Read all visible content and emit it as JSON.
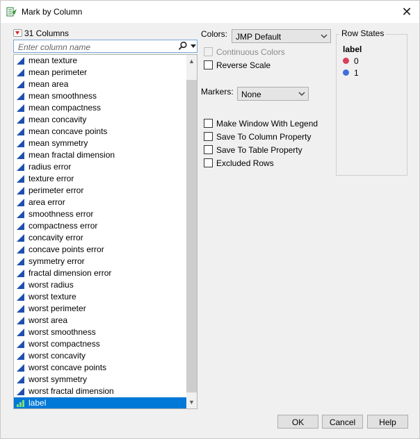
{
  "window": {
    "title": "Mark by Column",
    "close_glyph": "✕"
  },
  "columns": {
    "count_label": "31 Columns",
    "search_placeholder": "Enter column name",
    "items": [
      {
        "label": "mean texture",
        "type": "continuous"
      },
      {
        "label": "mean perimeter",
        "type": "continuous"
      },
      {
        "label": "mean area",
        "type": "continuous"
      },
      {
        "label": "mean smoothness",
        "type": "continuous"
      },
      {
        "label": "mean compactness",
        "type": "continuous"
      },
      {
        "label": "mean concavity",
        "type": "continuous"
      },
      {
        "label": "mean concave points",
        "type": "continuous"
      },
      {
        "label": "mean symmetry",
        "type": "continuous"
      },
      {
        "label": "mean fractal dimension",
        "type": "continuous"
      },
      {
        "label": "radius error",
        "type": "continuous"
      },
      {
        "label": "texture error",
        "type": "continuous"
      },
      {
        "label": "perimeter error",
        "type": "continuous"
      },
      {
        "label": "area error",
        "type": "continuous"
      },
      {
        "label": "smoothness error",
        "type": "continuous"
      },
      {
        "label": "compactness error",
        "type": "continuous"
      },
      {
        "label": "concavity error",
        "type": "continuous"
      },
      {
        "label": "concave points error",
        "type": "continuous"
      },
      {
        "label": "symmetry error",
        "type": "continuous"
      },
      {
        "label": "fractal dimension error",
        "type": "continuous"
      },
      {
        "label": "worst radius",
        "type": "continuous"
      },
      {
        "label": "worst texture",
        "type": "continuous"
      },
      {
        "label": "worst perimeter",
        "type": "continuous"
      },
      {
        "label": "worst area",
        "type": "continuous"
      },
      {
        "label": "worst smoothness",
        "type": "continuous"
      },
      {
        "label": "worst compactness",
        "type": "continuous"
      },
      {
        "label": "worst concavity",
        "type": "continuous"
      },
      {
        "label": "worst concave points",
        "type": "continuous"
      },
      {
        "label": "worst symmetry",
        "type": "continuous"
      },
      {
        "label": "worst fractal dimension",
        "type": "continuous"
      },
      {
        "label": "label",
        "type": "ordinal",
        "selected": true
      }
    ]
  },
  "colors": {
    "label": "Colors:",
    "value": "JMP Default"
  },
  "options": {
    "continuous_colors": {
      "label": "Continuous Colors",
      "checked": false,
      "disabled": true
    },
    "reverse_scale": {
      "label": "Reverse Scale",
      "checked": false
    }
  },
  "markers": {
    "label": "Markers:",
    "value": "None"
  },
  "save_options": [
    {
      "label": "Make Window With Legend",
      "checked": false
    },
    {
      "label": "Save To Column Property",
      "checked": false
    },
    {
      "label": "Save To Table Property",
      "checked": false
    },
    {
      "label": "Excluded Rows",
      "checked": false
    }
  ],
  "row_states": {
    "title": "Row States",
    "column": "label",
    "levels": [
      {
        "value": "0",
        "color": "#d8405a"
      },
      {
        "value": "1",
        "color": "#3f6fd8"
      }
    ]
  },
  "buttons": {
    "ok": "OK",
    "cancel": "Cancel",
    "help": "Help"
  },
  "colors_theme": {
    "selection": "#0078d7",
    "continuous_icon": "#1f4fb0",
    "ordinal_icon": "#2f9a2f"
  }
}
